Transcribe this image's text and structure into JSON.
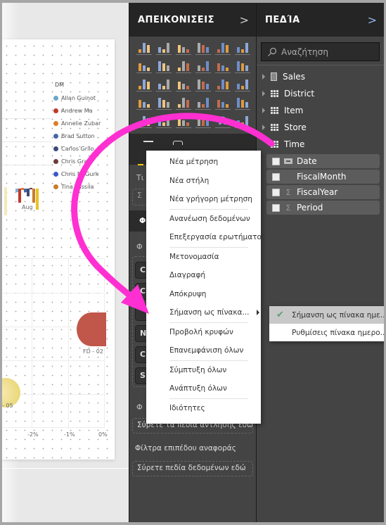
{
  "colors": {
    "accent_yellow": "#f2c811",
    "annotation_magenta": "#ff2fd2",
    "pane_bg": "#444444",
    "header_bg": "#252525",
    "check_green": "#5a9f7a"
  },
  "canvas": {
    "legend": {
      "title": "DM",
      "items": [
        {
          "label": "Allan Guinot",
          "color": "#6aa7c8"
        },
        {
          "label": "Andrew Ma",
          "color": "#c0392b"
        },
        {
          "label": "Annelie Zubar",
          "color": "#e07a27"
        },
        {
          "label": "Brad Sutton",
          "color": "#4567a9"
        },
        {
          "label": "Carlos Grilo",
          "color": "#3f4a78"
        },
        {
          "label": "Chris Gray",
          "color": "#6e3b3b"
        },
        {
          "label": "Chris McGurk",
          "color": "#3d56c9"
        },
        {
          "label": "Tina Lassila",
          "color": "#c97c2a"
        }
      ]
    },
    "column_chart": {
      "x_label": "Aug"
    },
    "scatter": {
      "x_ticks": [
        "-2%",
        "-1%",
        "0%"
      ],
      "bubbles": [
        {
          "label": "FD - 02",
          "color": "#c0574a"
        },
        {
          "label": "- 05",
          "color": "#e6d36a"
        }
      ]
    }
  },
  "visualizations": {
    "title": "ΑΠΕΙΚΟΝΙΣΕΙΣ",
    "chevron": ">",
    "icons": [
      "stacked-bar-icon",
      "stacked-column-icon",
      "clustered-bar-icon",
      "clustered-column-icon",
      "100-stacked-bar-icon",
      "100-stacked-column-icon",
      "line-chart-icon",
      "area-chart-icon",
      "stacked-area-icon",
      "line-clustered-column-icon",
      "line-stacked-column-icon",
      "ribbon-chart-icon",
      "waterfall-icon",
      "scatter-icon",
      "pie-chart-icon",
      "donut-chart-icon",
      "treemap-icon",
      "map-icon",
      "filled-map-icon",
      "shape-map-icon",
      "funnel-icon",
      "gauge-icon",
      "card-icon",
      "multi-row-card-icon",
      "kpi-icon",
      "slicer-icon",
      "table-icon",
      "matrix-icon",
      "r-visual-icon",
      "globe-icon"
    ],
    "more": "...",
    "partial_labels": {
      "values_label": "Τι",
      "sigma": "Σ",
      "filters_header": "Φ",
      "filters_label": "Φ",
      "pills": [
        "C",
        "C",
        "",
        "N",
        "C",
        "S"
      ],
      "page_filters_label": "Φ"
    },
    "drillthrough_well": "Σύρετε τα πεδία άντλησης εδώ",
    "report_filters_label": "Φίλτρα επιπέδου αναφοράς",
    "report_filters_well": "Σύρετε πεδία δεδομένων εδώ"
  },
  "fields": {
    "title": "ΠΕΔΊΑ",
    "chevron": ">",
    "search": {
      "placeholder": "Αναζήτηση"
    },
    "tables": [
      {
        "name": "Sales",
        "icon": "calculator-icon"
      },
      {
        "name": "District",
        "icon": "table-icon"
      },
      {
        "name": "Item",
        "icon": "table-icon"
      },
      {
        "name": "Store",
        "icon": "table-icon"
      },
      {
        "name": "Time",
        "icon": "table-icon"
      }
    ],
    "time_fields": [
      {
        "name": "Date",
        "type": "date"
      },
      {
        "name": "FiscalMonth",
        "type": "text"
      },
      {
        "name": "FiscalYear",
        "type": "sigma"
      },
      {
        "name": "Period",
        "type": "sigma"
      }
    ]
  },
  "context_menu": {
    "items": [
      "Νέα μέτρηση",
      "Νέα στήλη",
      "Νέα γρήγορη μέτρηση",
      "Ανανέωση δεδομένων",
      "Επεξεργασία ερωτήματος",
      "Μετονομασία",
      "Διαγραφή",
      "Απόκρυψη",
      "Σήμανση ως πίνακα...",
      "Προβολή κρυφών",
      "Επανεμφάνιση όλων",
      "Σύμπτυξη όλων",
      "Ανάπτυξη όλων",
      "Ιδιότητες"
    ],
    "submenu": [
      {
        "label": "Σήμανση ως πίνακα ημε...",
        "checked": true
      },
      {
        "label": "Ρυθμίσεις πίνακα ημερο...",
        "checked": false
      }
    ]
  }
}
